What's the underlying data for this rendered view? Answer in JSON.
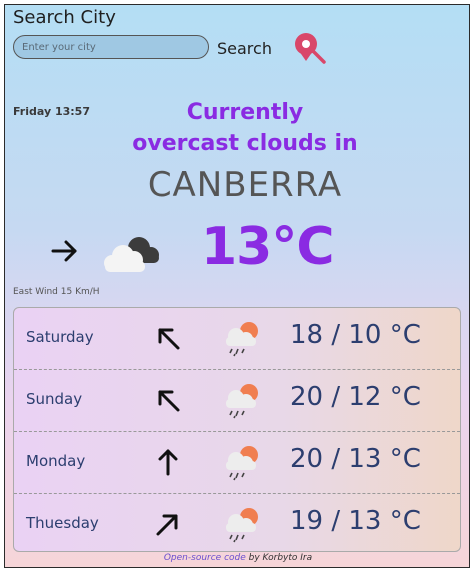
{
  "search": {
    "title": "Search City",
    "placeholder": "Enter your city",
    "button_label": "Search"
  },
  "current": {
    "datetime": "Friday 13:57",
    "headline_line1": "Currently",
    "headline_line2": "overcast clouds in",
    "city": "CANBERRA",
    "temperature": "13°C",
    "wind": "East Wind 15 Km/H",
    "wind_arrow_icon": "arrow-right-icon",
    "weather_icon": "overcast-clouds-icon"
  },
  "forecast": [
    {
      "day": "Saturday",
      "temps": "18 / 10 °C",
      "arrow_icon": "arrow-up-left-icon",
      "weather_icon": "sun-cloud-rain-icon"
    },
    {
      "day": "Sunday",
      "temps": "20 / 12 °C",
      "arrow_icon": "arrow-up-left-icon",
      "weather_icon": "sun-cloud-rain-icon"
    },
    {
      "day": "Monday",
      "temps": "20 / 13 °C",
      "arrow_icon": "arrow-up-icon",
      "weather_icon": "sun-cloud-rain-icon"
    },
    {
      "day": "Thuesday",
      "temps": "19 / 13 °C",
      "arrow_icon": "arrow-up-right-icon",
      "weather_icon": "sun-cloud-rain-icon"
    }
  ],
  "footer": {
    "link_text": "Open-source code",
    "author_text": " by Korbyto Ira"
  },
  "colors": {
    "accent": "#8a2be2",
    "forecast_text": "#2c3e6f",
    "pin": "#d9476a"
  }
}
